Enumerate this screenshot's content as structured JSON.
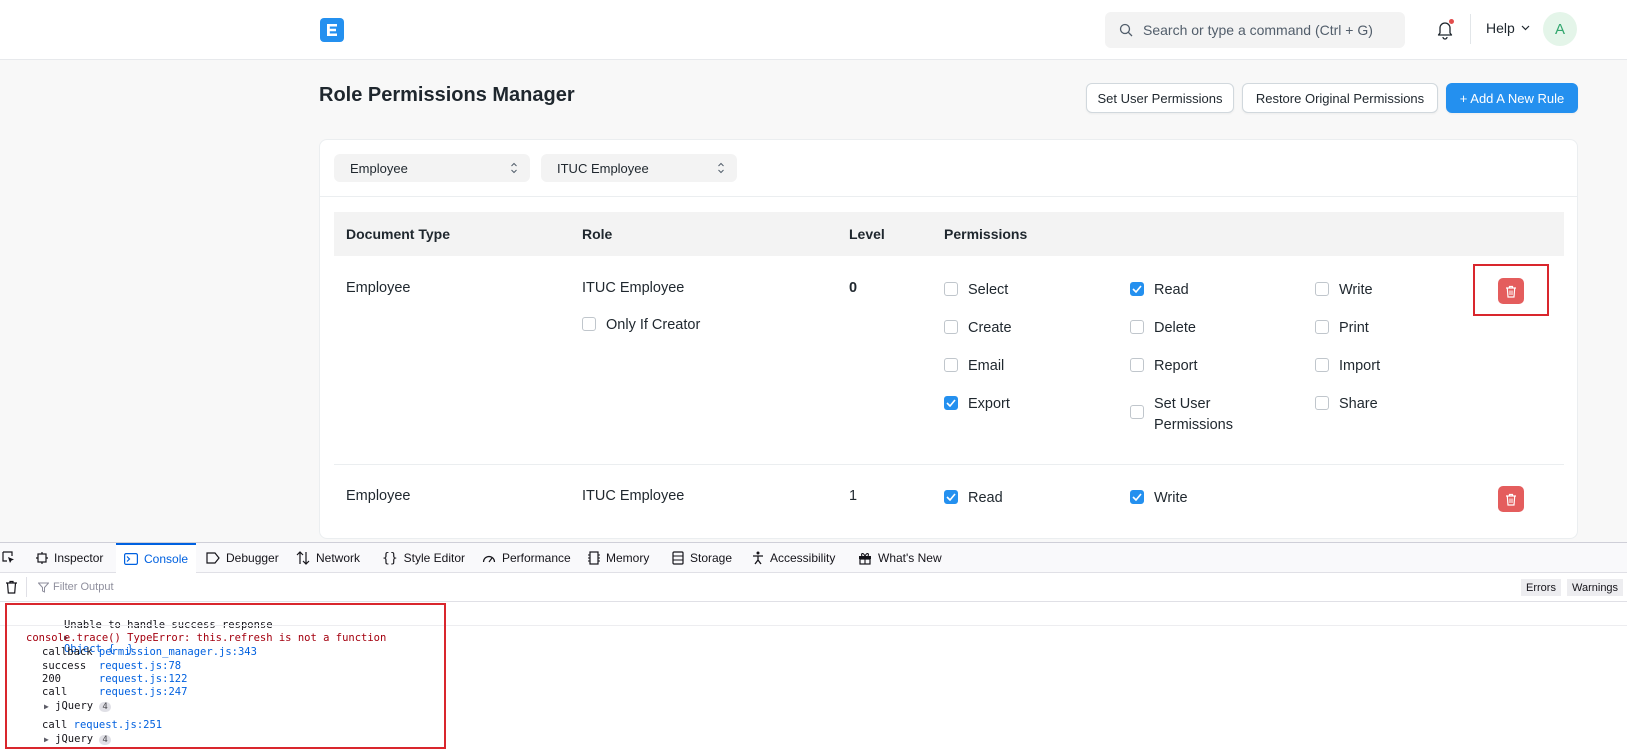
{
  "navbar": {
    "search_placeholder": "Search or type a command (Ctrl + G)",
    "help_label": "Help",
    "avatar_initial": "A"
  },
  "page": {
    "title": "Role Permissions Manager",
    "buttons": {
      "set_user_permissions": "Set User Permissions",
      "restore": "Restore Original Permissions",
      "add_rule": "+ Add A New Rule"
    }
  },
  "filters": {
    "doctype": "Employee",
    "role": "ITUC Employee"
  },
  "table": {
    "headers": [
      "Document Type",
      "Role",
      "Level",
      "Permissions"
    ],
    "rows": [
      {
        "document_type": "Employee",
        "role": "ITUC Employee",
        "level": "0",
        "only_if_creator": "Only If Creator",
        "permissions": [
          {
            "label": "Select",
            "checked": false
          },
          {
            "label": "Read",
            "checked": true
          },
          {
            "label": "Write",
            "checked": false
          },
          {
            "label": "Create",
            "checked": false
          },
          {
            "label": "Delete",
            "checked": false
          },
          {
            "label": "Print",
            "checked": false
          },
          {
            "label": "Email",
            "checked": false
          },
          {
            "label": "Report",
            "checked": false
          },
          {
            "label": "Import",
            "checked": false
          },
          {
            "label": "Export",
            "checked": true
          },
          {
            "label": "Set User Permissions",
            "checked": false
          },
          {
            "label": "Share",
            "checked": false
          }
        ]
      },
      {
        "document_type": "Employee",
        "role": "ITUC Employee",
        "level": "1",
        "permissions": [
          {
            "label": "Read",
            "checked": true
          },
          {
            "label": "Write",
            "checked": true
          }
        ]
      }
    ]
  },
  "devtools": {
    "tabs": [
      "Inspector",
      "Console",
      "Debugger",
      "Network",
      "Style Editor",
      "Performance",
      "Memory",
      "Storage",
      "Accessibility",
      "What's New"
    ],
    "filter_placeholder": "Filter Output",
    "chips": [
      "Errors",
      "Warnings"
    ],
    "console": {
      "line1_text": "Unable to handle success response",
      "line1_obj": "Object {  }",
      "trace_head": "console.trace() TypeError: this.refresh is not a function",
      "frames": [
        {
          "fn": "callback",
          "loc": "permission_manager.js:343"
        },
        {
          "fn": "success ",
          "loc": "request.js:78"
        },
        {
          "fn": "200     ",
          "loc": "request.js:122"
        },
        {
          "fn": "call    ",
          "loc": "request.js:247"
        }
      ],
      "jquery_label": "jQuery",
      "jquery_count": "4",
      "call2_fn": "call",
      "call2_loc": "request.js:251"
    }
  },
  "colors": {
    "primary": "#2490ef",
    "danger": "#e45d5d",
    "highlight": "#d9262d"
  }
}
